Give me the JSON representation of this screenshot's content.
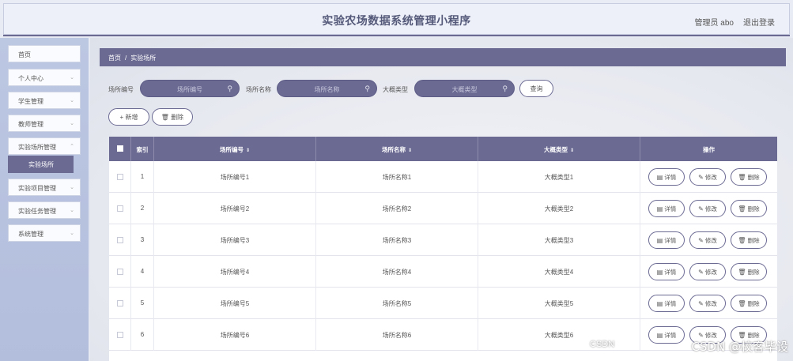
{
  "header": {
    "title": "实验农场数据系统管理小程序",
    "admin": "管理员 abo",
    "logout": "退出登录"
  },
  "sidebar": {
    "items": [
      {
        "label": "首页",
        "has_chevron": false
      },
      {
        "label": "个人中心",
        "has_chevron": true
      },
      {
        "label": "学生管理",
        "has_chevron": true
      },
      {
        "label": "教师管理",
        "has_chevron": true
      },
      {
        "label": "实验场所管理",
        "has_chevron": true
      },
      {
        "label": "实验项目管理",
        "has_chevron": true
      },
      {
        "label": "实验任务管理",
        "has_chevron": true
      },
      {
        "label": "系统管理",
        "has_chevron": true
      }
    ],
    "active_sub": "实验场所"
  },
  "breadcrumb": {
    "home": "首页",
    "separator": "/",
    "current": "实验场所"
  },
  "search": {
    "field1_label": "场所编号",
    "field1_placeholder": "场所编号",
    "field2_label": "场所名称",
    "field2_placeholder": "场所名称",
    "field3_label": "大概类型",
    "field3_placeholder": "大概类型",
    "search_button": "查询"
  },
  "actions": {
    "add_label": "+ 新增",
    "delete_label": "🗑 删除"
  },
  "table": {
    "columns": {
      "index": "索引",
      "code": "场所编号",
      "name": "场所名称",
      "type": "大概类型",
      "ops": "操作"
    },
    "sort_glyph": "⇕",
    "rows": [
      {
        "index": "1",
        "code": "场所编号1",
        "name": "场所名称1",
        "type": "大概类型1"
      },
      {
        "index": "2",
        "code": "场所编号2",
        "name": "场所名称2",
        "type": "大概类型2"
      },
      {
        "index": "3",
        "code": "场所编号3",
        "name": "场所名称3",
        "type": "大概类型3"
      },
      {
        "index": "4",
        "code": "场所编号4",
        "name": "场所名称4",
        "type": "大概类型4"
      },
      {
        "index": "5",
        "code": "场所编号5",
        "name": "场所名称5",
        "type": "大概类型5"
      },
      {
        "index": "6",
        "code": "场所编号6",
        "name": "场所名称6",
        "type": "大概类型6"
      }
    ],
    "row_buttons": {
      "detail": "详情",
      "edit": "修改",
      "delete": "删除"
    }
  },
  "icons": {
    "detail": "document-icon",
    "edit": "pencil-icon",
    "delete": "trash-icon",
    "search": "search-icon",
    "chevron": "chevron-down-icon"
  },
  "watermark": "CSDN @校客毕设",
  "watermark_small": "CSDN",
  "colors": {
    "accent": "#6b6a93",
    "sidebar_bg": "#b3bedd",
    "header_bg": "#edf0f8"
  }
}
